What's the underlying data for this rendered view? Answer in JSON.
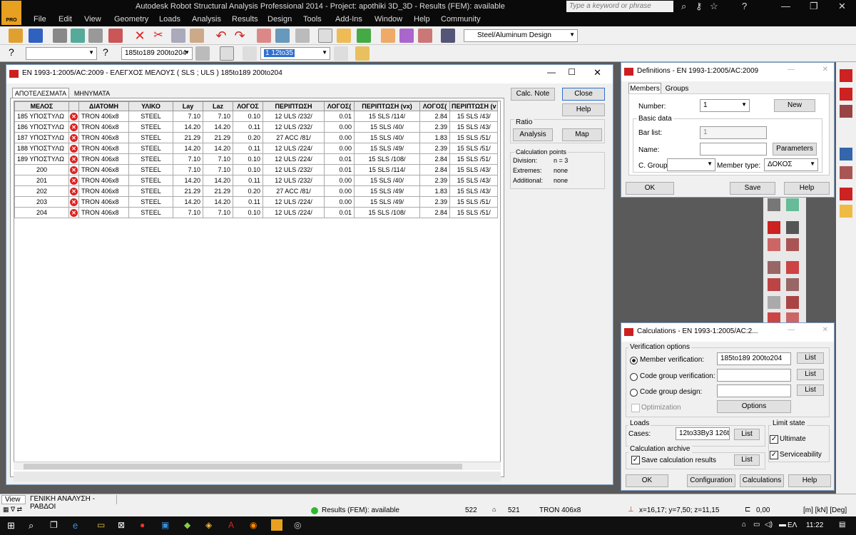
{
  "app": {
    "title": "Autodesk Robot Structural Analysis Professional 2014 - Project: apothiki 3D_3D - Results (FEM): available",
    "logo_text": "PRO",
    "search_placeholder": "Type a keyword or phrase"
  },
  "menu": [
    "File",
    "Edit",
    "View",
    "Geometry",
    "Loads",
    "Analysis",
    "Results",
    "Design",
    "Tools",
    "Add-Ins",
    "Window",
    "Help",
    "Community"
  ],
  "toolbar": {
    "design_combo": "Steel/Aluminum Design",
    "bars_combo": "185to189 200to204",
    "cases_combo": "1 12to35"
  },
  "main_dialog": {
    "title": "EN 1993-1:2005/AC:2009 - ΕΛΕΓΧΟΣ ΜΕΛΟΥΣ ( SLS ; ULS ) 185to189 200to204",
    "tabs": [
      "ΑΠΟΤΕΛΕΣΜΑΤΑ",
      "ΜΗΝΥΜΑΤΑ"
    ],
    "columns": [
      "ΜΕΛΟΣ",
      "ΔΙΑΤΟΜΗ",
      "ΥΛΙΚΟ",
      "Lay",
      "Laz",
      "ΛΟΓΟΣ",
      "ΠΕΡΙΠΤΩΣΗ",
      "ΛΟΓΟΣ(",
      "ΠΕΡΙΠΤΩΣΗ (vx)",
      "ΛΟΓΟΣ(",
      "ΠΕΡΙΠΤΩΣΗ (v"
    ],
    "rows": [
      [
        "185 ΥΠΟΣΤΥΛΩ",
        "TRON 406x8",
        "STEEL",
        "7.10",
        "7.10",
        "0.10",
        "12 ULS /232/",
        "0.01",
        "15 SLS /114/",
        "2.84",
        "15 SLS /43/"
      ],
      [
        "186 ΥΠΟΣΤΥΛΩ",
        "TRON 406x8",
        "STEEL",
        "14.20",
        "14.20",
        "0.11",
        "12 ULS /232/",
        "0.00",
        "15 SLS /40/",
        "2.39",
        "15 SLS /43/"
      ],
      [
        "187 ΥΠΟΣΤΥΛΩ",
        "TRON 406x8",
        "STEEL",
        "21.29",
        "21.29",
        "0.20",
        "27 ACC /81/",
        "0.00",
        "15 SLS /40/",
        "1.83",
        "15 SLS /51/"
      ],
      [
        "188 ΥΠΟΣΤΥΛΩ",
        "TRON 406x8",
        "STEEL",
        "14.20",
        "14.20",
        "0.11",
        "12 ULS /224/",
        "0.00",
        "15 SLS /49/",
        "2.39",
        "15 SLS /51/"
      ],
      [
        "189 ΥΠΟΣΤΥΛΩ",
        "TRON 406x8",
        "STEEL",
        "7.10",
        "7.10",
        "0.10",
        "12 ULS /224/",
        "0.01",
        "15 SLS /108/",
        "2.84",
        "15 SLS /51/"
      ],
      [
        "200",
        "TRON 406x8",
        "STEEL",
        "7.10",
        "7.10",
        "0.10",
        "12 ULS /232/",
        "0.01",
        "15 SLS /114/",
        "2.84",
        "15 SLS /43/"
      ],
      [
        "201",
        "TRON 406x8",
        "STEEL",
        "14.20",
        "14.20",
        "0.11",
        "12 ULS /232/",
        "0.00",
        "15 SLS /40/",
        "2.39",
        "15 SLS /43/"
      ],
      [
        "202",
        "TRON 406x8",
        "STEEL",
        "21.29",
        "21.29",
        "0.20",
        "27 ACC /81/",
        "0.00",
        "15 SLS /49/",
        "1.83",
        "15 SLS /43/"
      ],
      [
        "203",
        "TRON 406x8",
        "STEEL",
        "14.20",
        "14.20",
        "0.11",
        "12 ULS /224/",
        "0.00",
        "15 SLS /49/",
        "2.39",
        "15 SLS /51/"
      ],
      [
        "204",
        "TRON 406x8",
        "STEEL",
        "7.10",
        "7.10",
        "0.10",
        "12 ULS /224/",
        "0.01",
        "15 SLS /108/",
        "2.84",
        "15 SLS /51/"
      ]
    ],
    "buttons": {
      "calc_note": "Calc. Note",
      "close": "Close",
      "help": "Help",
      "analysis": "Analysis",
      "map": "Map"
    },
    "ratio_label": "Ratio",
    "calc_points": {
      "title": "Calculation points",
      "division_label": "Division:",
      "division_value": "n = 3",
      "extremes_label": "Extremes:",
      "extremes_value": "none",
      "additional_label": "Additional:",
      "additional_value": "none"
    }
  },
  "definitions": {
    "title": "Definitions - EN 1993-1:2005/AC:2009",
    "tabs": [
      "Members",
      "Groups"
    ],
    "number_label": "Number:",
    "number_value": "1",
    "new_btn": "New",
    "basic_data": "Basic data",
    "bar_list_label": "Bar list:",
    "bar_list_value": "1",
    "name_label": "Name:",
    "parameters_btn": "Parameters",
    "cgroup_label": "C. Group:",
    "member_type_label": "Member type:",
    "member_type_value": "ΔΟΚΟΣ",
    "ok": "OK",
    "save": "Save",
    "help": "Help"
  },
  "calculations": {
    "title": "Calculations - EN 1993-1:2005/AC:2...",
    "verification_options": "Verification options",
    "member_verification": "Member verification:",
    "member_value": "185to189 200to204",
    "code_group_verification": "Code group verification:",
    "code_group_design": "Code group design:",
    "optimization": "Optimization",
    "options_btn": "Options",
    "list_btn": "List",
    "loads": "Loads",
    "cases_label": "Cases:",
    "cases_value": "12to33By3 126to",
    "limit_state": "Limit state",
    "ultimate": "Ultimate",
    "serviceability": "Serviceability",
    "calc_archive": "Calculation archive",
    "save_results": "Save calculation results",
    "ok": "OK",
    "configuration": "Configuration",
    "calculations_btn": "Calculations",
    "help": "Help"
  },
  "statusbar": {
    "view_tab": "View",
    "analysis_tab": "ΓΕΝΙΚΗ ΑΝΑΛΥΣΗ - ΡΑΒΔΟΙ",
    "results_status": "Results (FEM): available",
    "nodes": "522",
    "bars": "521",
    "section": "TRON 406x8",
    "coords": "x=16,17; y=7,50; z=11,15",
    "value": "0,00",
    "units": "[m] [kN] [Deg]"
  },
  "taskbar": {
    "lang": "ΕΛ",
    "time": "11:22"
  },
  "colors": {
    "accent": "#cc2020",
    "statusgreen": "#2eb82e"
  }
}
